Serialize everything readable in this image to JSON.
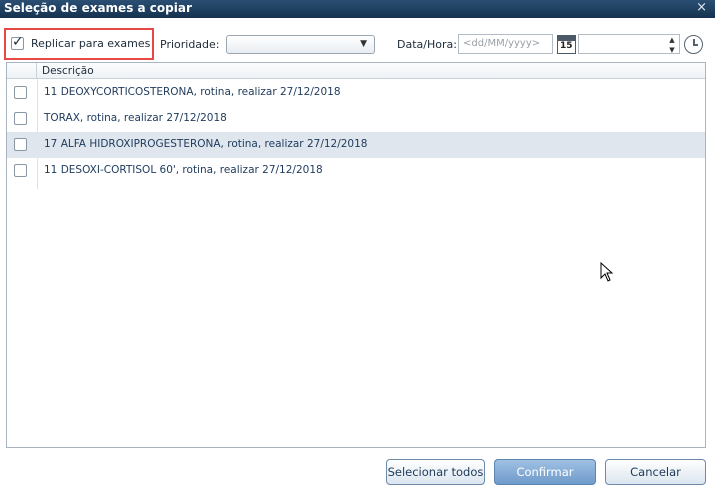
{
  "window": {
    "title": "Seleção de exames a copiar",
    "close_glyph": "×"
  },
  "toolbar": {
    "replicate_label": "Replicar para exames",
    "replicate_checked": true,
    "priority_label": "Prioridade:",
    "priority_value": "",
    "datetime_label": "Data/Hora:",
    "date_placeholder": "<dd/MM/yyyy>",
    "calendar_day": "15",
    "time_value": ""
  },
  "grid": {
    "header": "Descrição",
    "rows": [
      {
        "text": "11 DEOXYCORTICOSTERONA, rotina, realizar 27/12/2018",
        "checked": false,
        "selected": false
      },
      {
        "text": "TORAX, rotina, realizar 27/12/2018",
        "checked": false,
        "selected": false
      },
      {
        "text": "17 ALFA HIDROXIPROGESTERONA, rotina, realizar 27/12/2018",
        "checked": false,
        "selected": true
      },
      {
        "text": "11 DESOXI-CORTISOL 60', rotina, realizar 27/12/2018",
        "checked": false,
        "selected": false
      }
    ]
  },
  "buttons": {
    "select_all": "Selecionar todos",
    "confirm": "Confirmar",
    "cancel": "Cancelar"
  },
  "icons": {
    "checkbox": "checkbox-icon",
    "calendar": "calendar-icon",
    "clock": "clock-icon",
    "dropdown": "chevron-down-icon",
    "close": "close-icon",
    "cursor": "mouse-pointer-icon"
  }
}
